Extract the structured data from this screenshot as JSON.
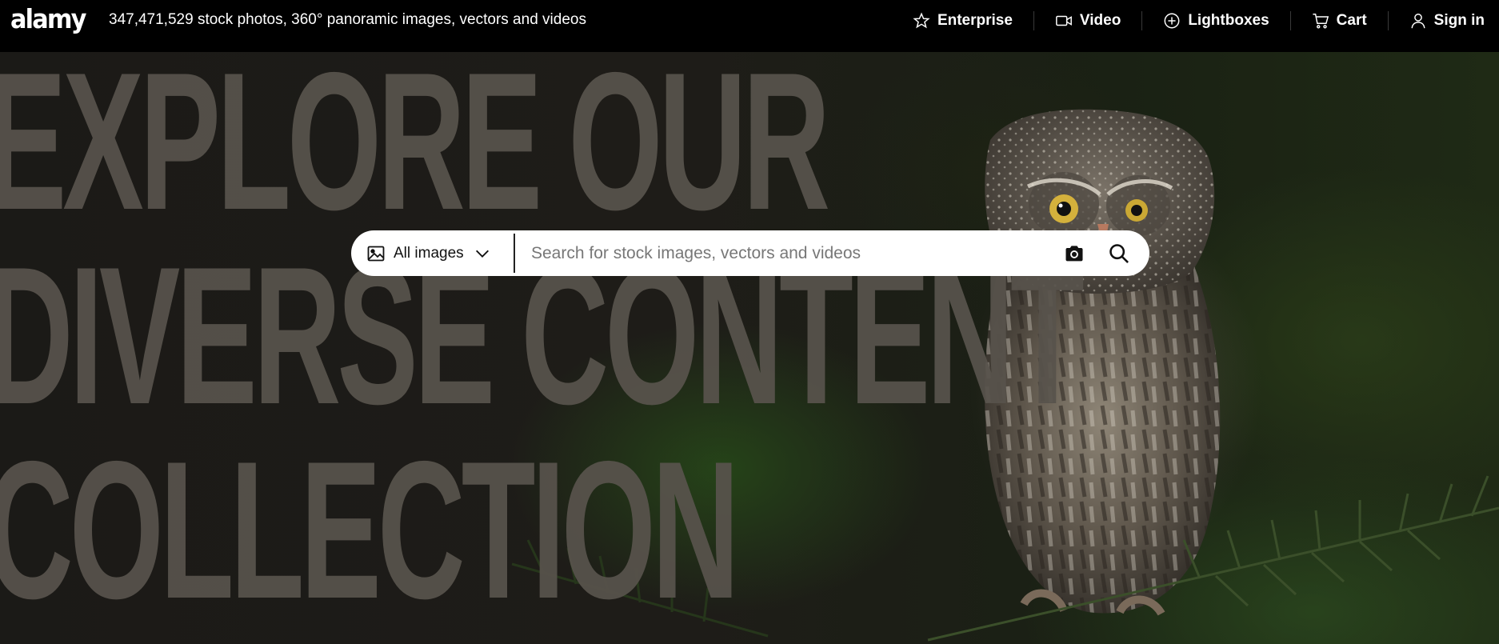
{
  "header": {
    "logo": "alamy",
    "tagline": "347,471,529 stock photos, 360° panoramic images, vectors and videos",
    "nav": [
      {
        "label": "Enterprise",
        "icon": "star-icon"
      },
      {
        "label": "Video",
        "icon": "video-camera-icon"
      },
      {
        "label": "Lightboxes",
        "icon": "plus-circle-icon"
      },
      {
        "label": "Cart",
        "icon": "cart-icon"
      },
      {
        "label": "Sign in",
        "icon": "user-icon"
      }
    ]
  },
  "hero": {
    "headline_lines": [
      "EXPLORE OUR",
      "DIVERSE CONTENT",
      "COLLECTION"
    ],
    "background": "owl-perched-on-pine-branch"
  },
  "search": {
    "type_label": "All images",
    "placeholder": "Search for stock images, vectors and videos",
    "value": ""
  },
  "colors": {
    "topbar": "#000000",
    "headline": "#58534c",
    "search_bg": "#ffffff"
  }
}
